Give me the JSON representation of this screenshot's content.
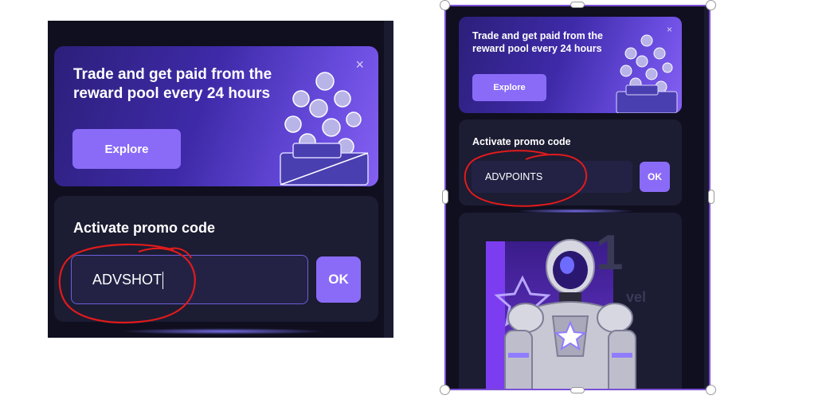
{
  "left_screenshot": {
    "banner": {
      "title": "Trade and get paid from the reward pool every 24 hours",
      "explore_label": "Explore",
      "close_glyph": "×"
    },
    "promo": {
      "heading": "Activate promo code",
      "code_value": "ADVSHOT",
      "ok_label": "OK"
    }
  },
  "right_screenshot": {
    "banner": {
      "title": "Trade and get paid from the reward pool every 24 hours",
      "explore_label": "Explore",
      "close_glyph": "×"
    },
    "promo": {
      "heading": "Activate promo code",
      "code_value": "ADVPOINTS",
      "ok_label": "OK"
    },
    "hero_card": {
      "level_number": "1",
      "level_word": "vel"
    }
  },
  "colors": {
    "accent": "#8a6bf8",
    "panel": "#1c1c33",
    "background": "#0f0f1f",
    "annotation": "#e01b1b",
    "selection": "#7b4fd6"
  },
  "icons": [
    "close-icon",
    "coin-pile-illustration",
    "robot-character-illustration"
  ]
}
